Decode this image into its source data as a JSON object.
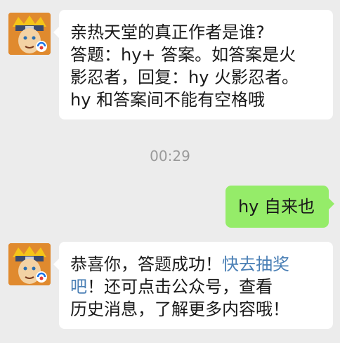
{
  "chat": {
    "messages": [
      {
        "side": "left",
        "lines": [
          "亲热天堂的真正作者是谁?",
          "答题：hy+ 答案。如答案是火",
          "影忍者，回复：hy 火影忍者。",
          "hy 和答案间不能有空格哦"
        ]
      },
      {
        "type": "time",
        "text": "00:29"
      },
      {
        "side": "right",
        "text": "hy 自来也"
      },
      {
        "side": "left",
        "line1_plain": "恭喜你，答题成功！",
        "line1_link": "快去抽奖",
        "line2_link": "吧",
        "line2_plain": "！还可点击公众号，查看",
        "line3": "历史消息，了解更多内容哦！"
      }
    ]
  },
  "colors": {
    "background": "#ececec",
    "bubble_left": "#ffffff",
    "bubble_right": "#95ec69",
    "link": "#4a7fb5",
    "timestamp": "#9a9a9a"
  },
  "icons": {
    "avatar": "naruto-avatar-icon",
    "badge": "tencent-games-badge-icon"
  }
}
